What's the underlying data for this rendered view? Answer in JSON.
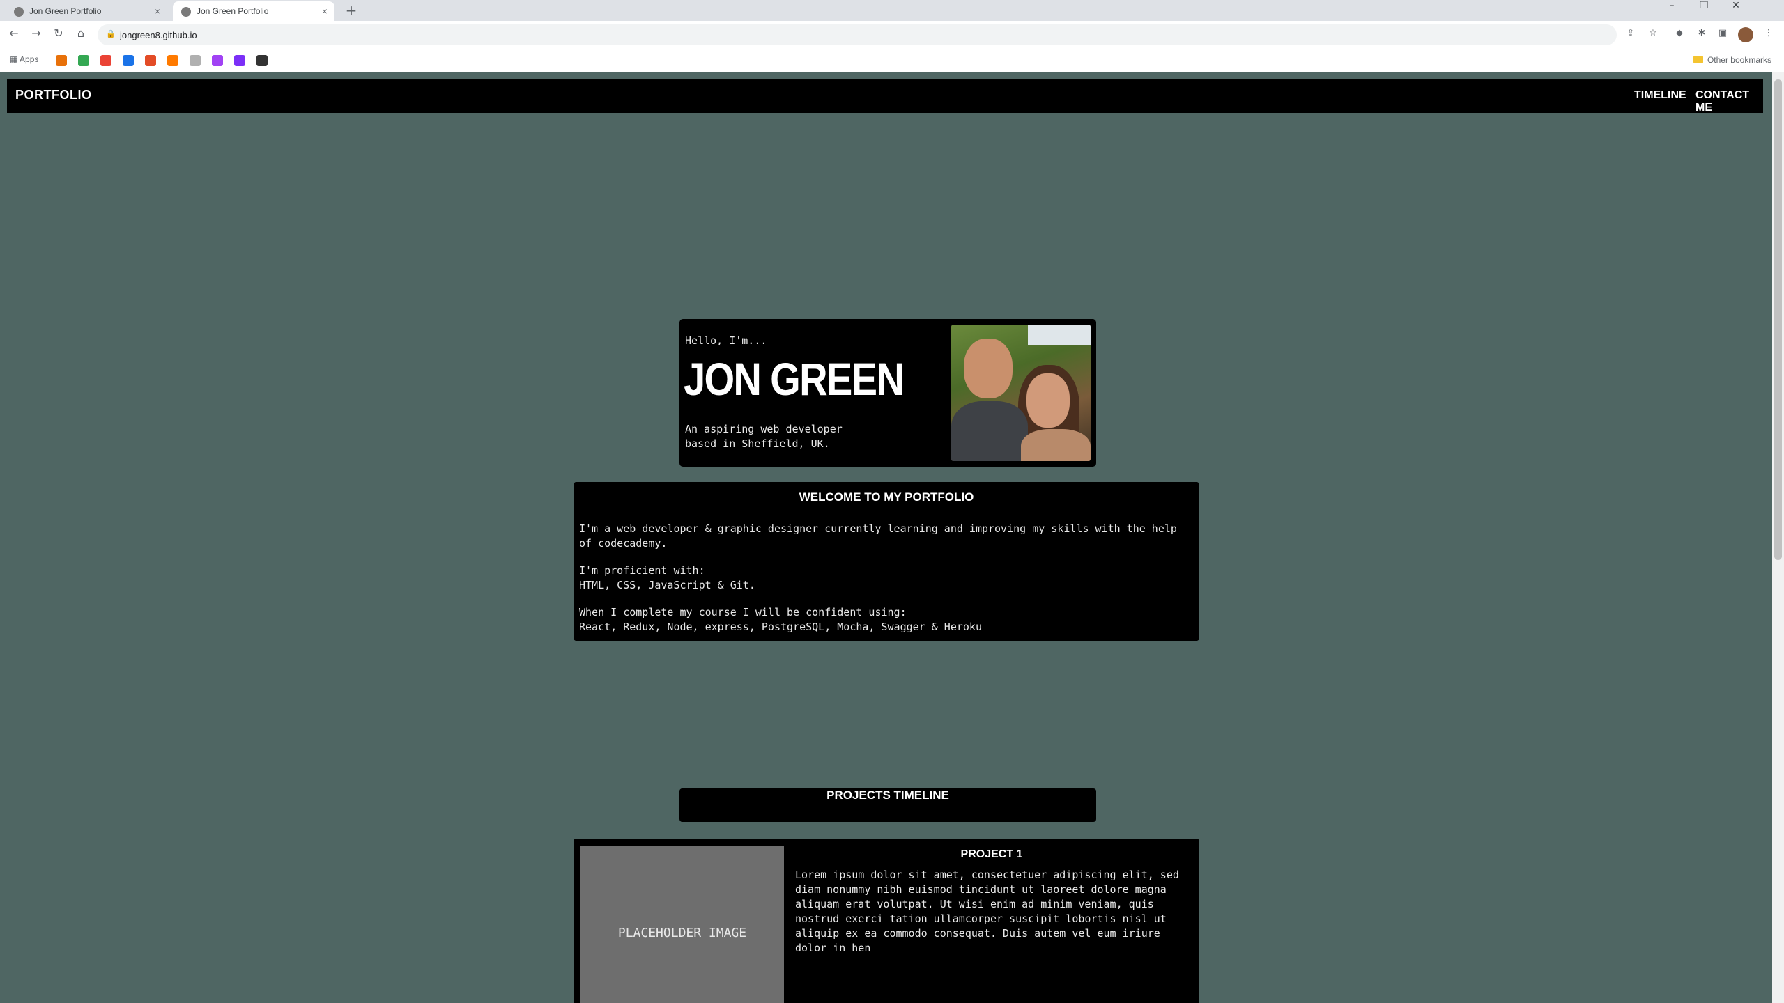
{
  "browser": {
    "tabs": [
      {
        "title": "Jon Green Portfolio",
        "active": false
      },
      {
        "title": "Jon Green Portfolio",
        "active": true
      }
    ],
    "url": "jongreen8.github.io",
    "bookmarks_apps_label": "Apps",
    "other_bookmarks_label": "Other bookmarks",
    "bookmark_colors": [
      "#e8710a",
      "#34a853",
      "#ea4335",
      "#1a73e8",
      "#e34c26",
      "#ff7a00",
      "#b0b0b0",
      "#a142f4",
      "#7b2ff7",
      "#333333"
    ]
  },
  "nav": {
    "brand": "PORTFOLIO",
    "timeline": "TIMELINE",
    "contact": "CONTACT ME"
  },
  "hero": {
    "greeting": "Hello, I'm...",
    "name": "JON GREEN",
    "tagline_line1": "An aspiring web developer",
    "tagline_line2": "based in Sheffield, UK."
  },
  "about": {
    "heading": "WELCOME TO MY PORTFOLIO",
    "intro": "I'm a web developer & graphic designer currently learning and improving my skills with the help of codecademy.",
    "proficient_label": "I'm proficient with:",
    "proficient_list": "HTML, CSS, JavaScript & Git.",
    "future_label": "When I complete my course I will be confident using:",
    "future_list": "React, Redux, Node, express, PostgreSQL, Mocha, Swagger & Heroku"
  },
  "timeline": {
    "heading": "PROJECTS TIMELINE"
  },
  "project1": {
    "image_label": "PLACEHOLDER IMAGE",
    "title": "PROJECT 1",
    "body": "Lorem ipsum dolor sit amet, consectetuer adipiscing elit, sed diam nonummy nibh euismod tincidunt ut laoreet dolore magna aliquam erat volutpat. Ut wisi enim ad minim veniam, quis nostrud exerci tation ullamcorper suscipit lobortis nisl ut aliquip ex ea commodo consequat. Duis autem vel eum iriure dolor in hen"
  },
  "colors": {
    "page_background": "#4f6663",
    "panel": "#000000",
    "placeholder": "#6e6e6e"
  }
}
